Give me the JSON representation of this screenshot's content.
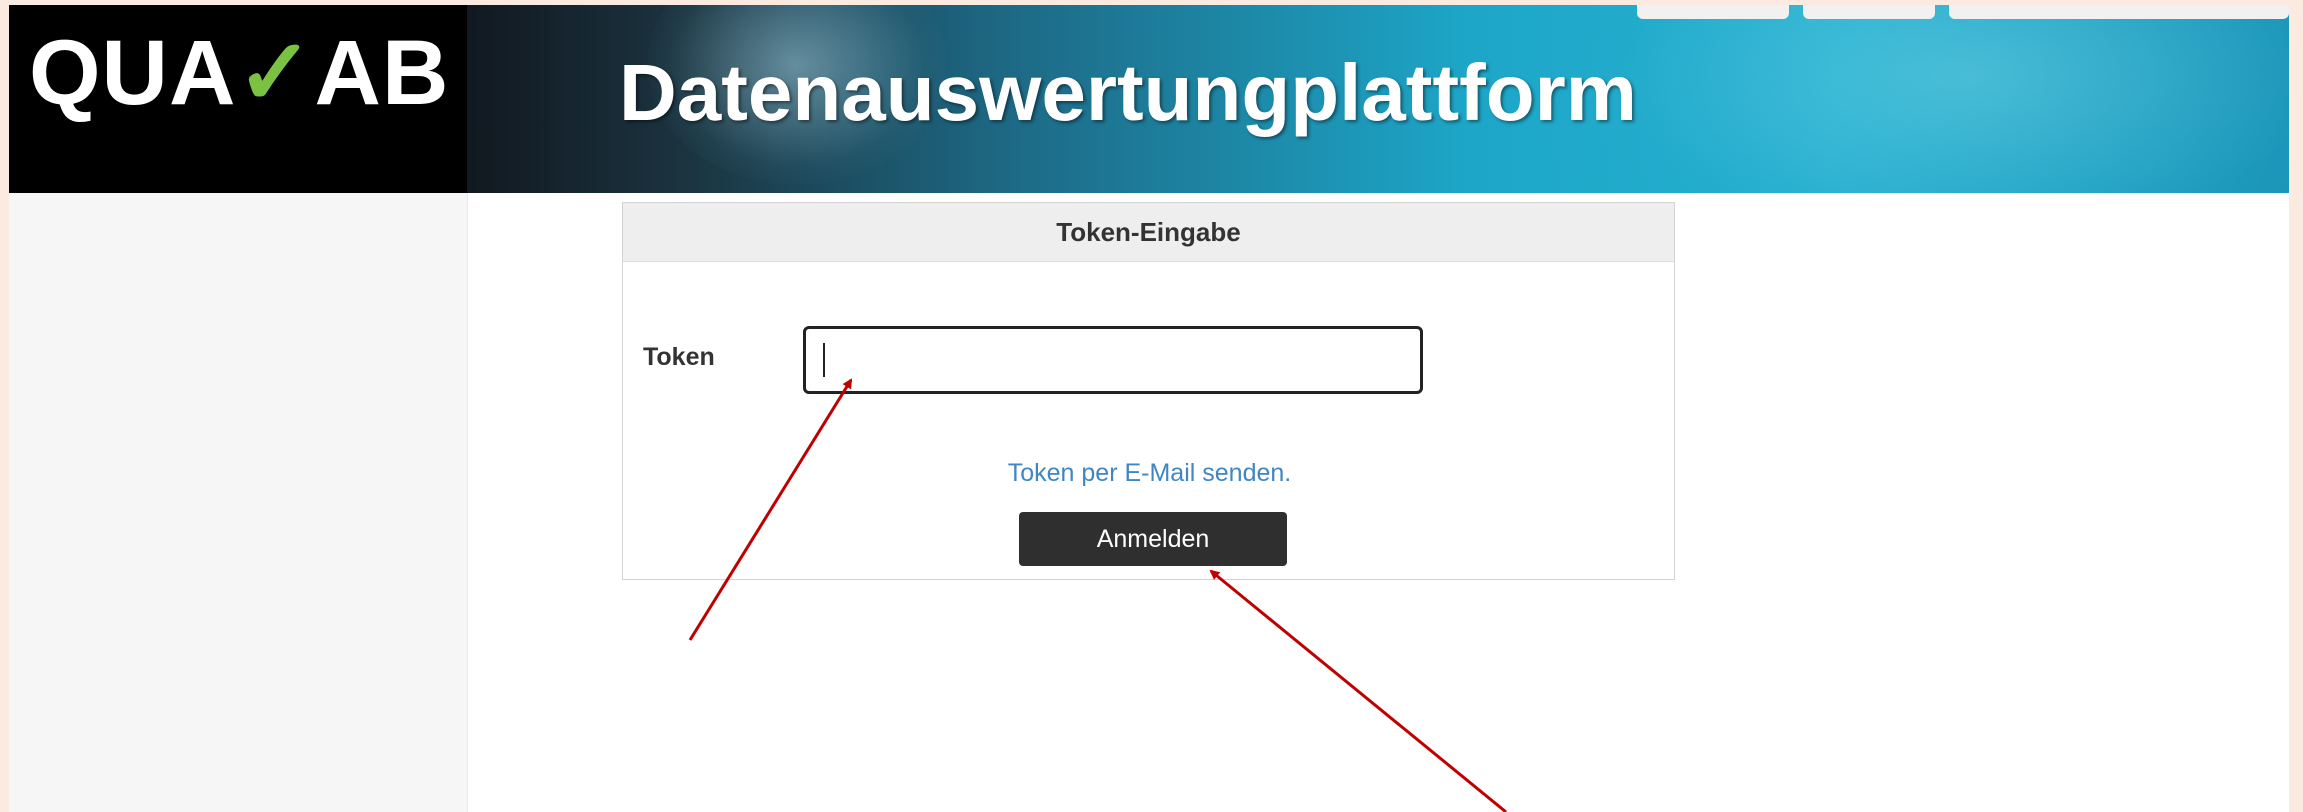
{
  "header": {
    "logo_left": "QUA",
    "logo_check": "✓",
    "logo_right": "AB",
    "title": "Datenauswertungplattform"
  },
  "panel": {
    "title": "Token-Eingabe",
    "token_label": "Token",
    "token_value": "",
    "mail_link": "Token per E-Mail senden.",
    "submit_label": "Anmelden"
  },
  "colors": {
    "accent_check": "#7cc242",
    "button": "#2f2f2f",
    "link": "#3f86c3",
    "annotation_arrow": "#c00000"
  }
}
